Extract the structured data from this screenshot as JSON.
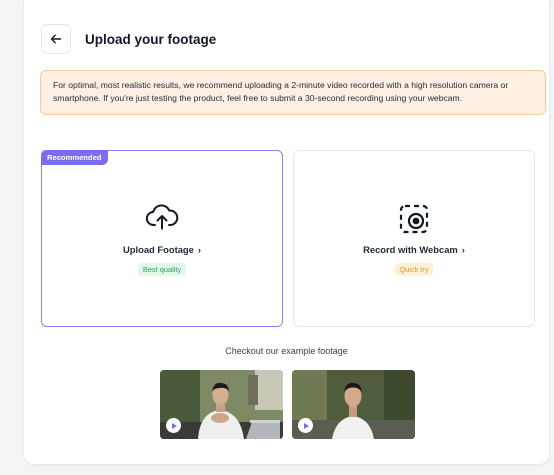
{
  "header": {
    "back_icon": "arrow-left-icon",
    "title": "Upload your footage"
  },
  "notice": {
    "text": "For optimal, most realistic results, we recommend uploading a 2-minute video recorded with a high resolution camera or smartphone. If you're just testing the product, feel free to submit a 30-second recording using your webcam."
  },
  "options": [
    {
      "badge": "Recommended",
      "icon": "cloud-upload-icon",
      "label": "Upload Footage",
      "chevron": "›",
      "tag": "Best quality",
      "tag_color": "#2e9e63"
    },
    {
      "icon": "record-webcam-icon",
      "label": "Record with Webcam",
      "chevron": "›",
      "tag": "Quick try",
      "tag_color": "#e49a26"
    }
  ],
  "examples": {
    "heading": "Checkout our example footage",
    "thumbnails": [
      {
        "icon": "play-icon"
      },
      {
        "icon": "play-icon"
      }
    ]
  },
  "colors": {
    "accent": "#7c6cf0",
    "notice_bg": "#fdf0e3",
    "notice_border": "#f6c99a"
  }
}
